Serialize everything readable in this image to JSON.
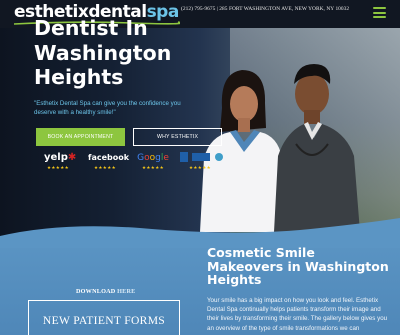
{
  "header": {
    "logo_main": "esthetixdental",
    "logo_accent": "spa",
    "contact": "(212) 795-9675 | 285 FORT WASHINGTON AVE, NEW YORK, NY 10032",
    "menu_icon": "hamburger-icon"
  },
  "hero": {
    "title": "Dentist In Washington Heights",
    "subtitle": "\"Esthetix Dental Spa can give you the confidence you deserve with a healthy smile!\"",
    "appointment_button": "BOOK AN APPOINTMENT",
    "why_button": "WHY ESTHETIX",
    "reviews": {
      "yelp": "yelp",
      "facebook": "facebook",
      "google": "Google",
      "stars": "★★★★★"
    }
  },
  "download": {
    "label": "DOWNLOAD",
    "link": "HERE",
    "button": "NEW PATIENT FORMS"
  },
  "cosmetic": {
    "title": "Cosmetic Smile Makeovers in Washington Heights",
    "body": "Your smile has a big impact on how you look and feel. Esthetix Dental Spa continually helps patients transform their image and their lives by transforming their smile. The gallery below gives you an overview of the type of smile transformations we can"
  },
  "colors": {
    "accent_green": "#8dc63f",
    "accent_blue": "#6cc4e8",
    "lower_blue": "#5b95c4"
  }
}
